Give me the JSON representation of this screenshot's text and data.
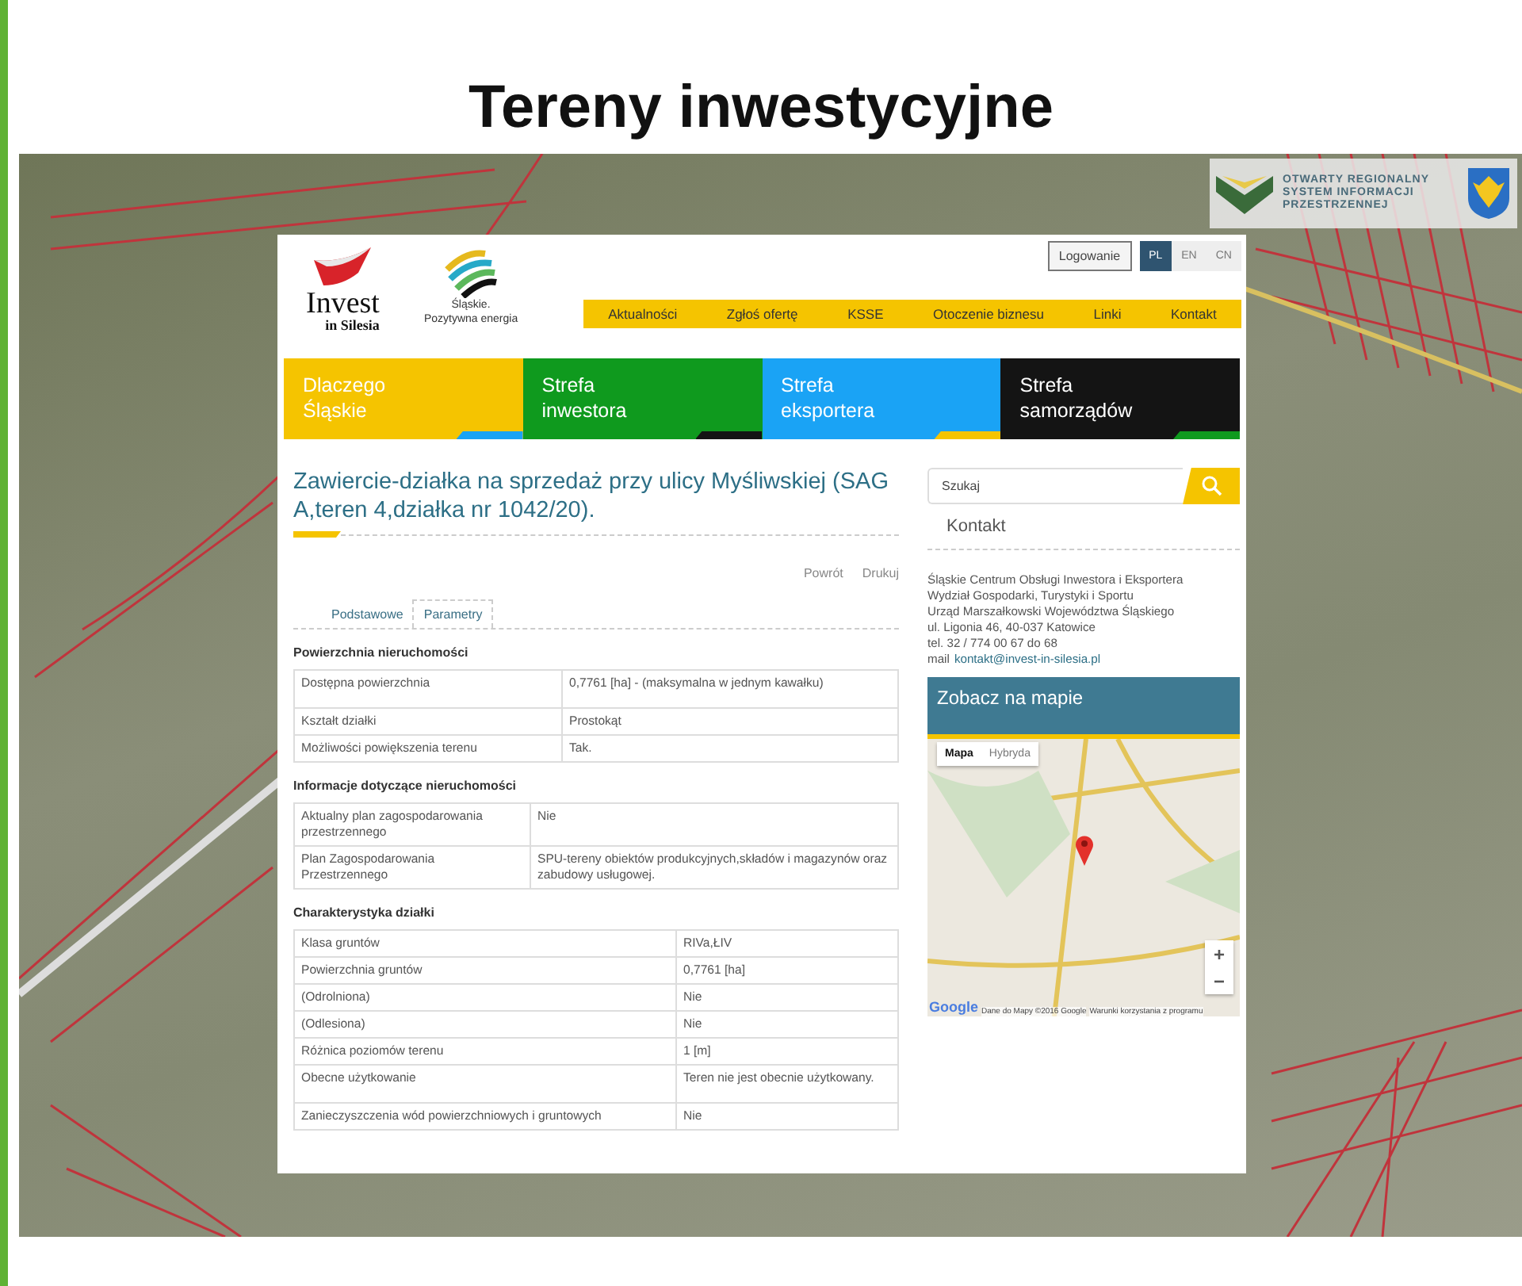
{
  "slide": {
    "title": "Tereny inwestycyjne"
  },
  "map_overlay": {
    "logo_lines": [
      "OTWARTY REGIONALNY",
      "SYSTEM INFORMACJI",
      "PRZESTRZENNEJ"
    ]
  },
  "page": {
    "logos": [
      {
        "kind": "invest",
        "lines": [
          "Invest",
          "in Silesia"
        ]
      },
      {
        "kind": "slaskie",
        "lines": [
          "Śląskie.",
          "Pozytywna energia"
        ]
      }
    ],
    "login_button": "Logowanie",
    "languages": [
      {
        "label": "PL",
        "selected": true
      },
      {
        "label": "EN",
        "selected": false
      },
      {
        "label": "CN",
        "selected": false
      }
    ],
    "nav": [
      "Aktualności",
      "Zgłoś ofertę",
      "KSSE",
      "Otoczenie biznesu",
      "Linki",
      "Kontakt"
    ],
    "tiles": [
      {
        "lines": [
          "Dlaczego",
          "Śląskie"
        ],
        "color": "#f5c400"
      },
      {
        "lines": [
          "Strefa",
          "inwestora"
        ],
        "color": "#0f9a1e"
      },
      {
        "lines": [
          "Strefa",
          "eksportera"
        ],
        "color": "#1aa3f5"
      },
      {
        "lines": [
          "Strefa",
          "samorządów"
        ],
        "color": "#141414"
      }
    ],
    "heading": "Zawiercie-działka na sprzedaż przy ulicy Myśliwskiej (SAG A,teren 4,działka nr 1042/20).",
    "actions": [
      "Powrót",
      "Drukuj"
    ],
    "tabs": [
      {
        "label": "Podstawowe",
        "selected": false
      },
      {
        "label": "Parametry",
        "selected": true
      }
    ],
    "sections": [
      {
        "title": "Powierzchnia nieruchomości",
        "rows": [
          [
            "Dostępna powierzchnia",
            "0,7761 [ha] - (maksymalna w jednym kawałku)"
          ],
          [
            "Kształt działki",
            "Prostokąt"
          ],
          [
            "Możliwości powiększenia terenu",
            "Tak."
          ]
        ]
      },
      {
        "title": "Informacje dotyczące nieruchomości",
        "rows": [
          [
            "Aktualny plan zagospodarowania przestrzennego",
            "Nie"
          ],
          [
            "Plan Zagospodarowania Przestrzennego",
            "SPU-tereny obiektów produkcyjnych,składów i magazynów oraz zabudowy usługowej."
          ]
        ]
      },
      {
        "title": "Charakterystyka działki",
        "rows": [
          [
            "Klasa gruntów",
            "RIVa,ŁIV"
          ],
          [
            "Powierzchnia gruntów",
            "0,7761 [ha]"
          ],
          [
            "(Odrolniona)",
            "Nie"
          ],
          [
            "(Odlesiona)",
            "Nie"
          ],
          [
            "Różnica poziomów terenu",
            "1 [m]"
          ],
          [
            "Obecne użytkowanie",
            "Teren nie jest obecnie użytkowany."
          ],
          [
            "Zanieczyszczenia wód powierzchniowych i gruntowych",
            "Nie"
          ]
        ]
      }
    ],
    "sidebar": {
      "search": {
        "placeholder": "Szukaj"
      },
      "contact_title": "Kontakt",
      "contact_lines": [
        "Śląskie Centrum Obsługi Inwestora i Eksportera",
        "Wydział Gospodarki, Turystyki i Sportu",
        "Urząd Marszałkowski Województwa Śląskiego",
        "ul. Ligonia 46, 40-037 Katowice",
        "tel. 32 / 774 00 67 do 68"
      ],
      "mail": {
        "label": "mail",
        "link": "kontakt@invest-in-silesia.pl"
      },
      "map": {
        "title": "Zobacz na mapie",
        "map_types": [
          {
            "label": "Mapa",
            "selected": true
          },
          {
            "label": "Hybryda",
            "selected": false
          }
        ],
        "zoom": [
          "+",
          "−"
        ],
        "google_logo": "Google",
        "attribution": "Dane do Mapy ©2016 Google",
        "terms": "Warunki korzystania z programu"
      }
    }
  }
}
